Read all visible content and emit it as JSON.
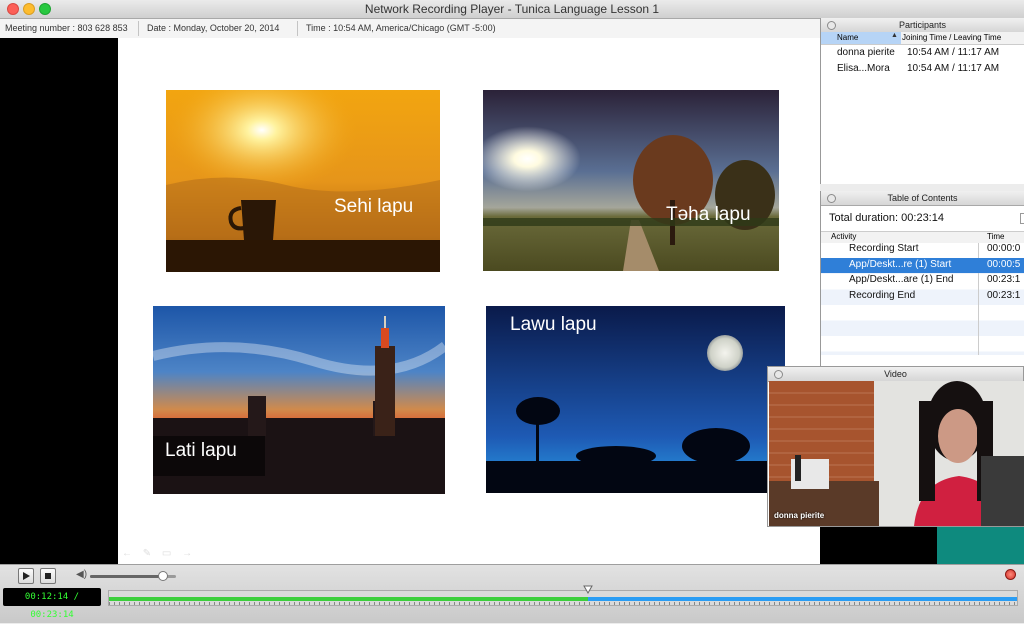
{
  "window": {
    "title": "Network Recording Player - Tunica Language Lesson 1"
  },
  "info": {
    "meeting": "Meeting number : 803 628 853",
    "date": "Date : Monday, October 20, 2014",
    "time": "Time : 10:54 AM, America/Chicago (GMT -5:00)"
  },
  "slide": {
    "captions": [
      "Sehi lapu",
      "Təha lapu",
      "Lati lapu",
      "Lawu lapu"
    ]
  },
  "participants": {
    "title": "Participants",
    "columns": [
      "Name",
      "Joining Time / Leaving Time"
    ],
    "rows": [
      {
        "name": "donna pierite",
        "times": "10:54 AM / 11:17 AM"
      },
      {
        "name": "Elisa...Mora",
        "times": "10:54 AM / 11:17 AM"
      }
    ]
  },
  "toc": {
    "title": "Table of Contents",
    "total": "Total duration: 00:23:14",
    "columns": [
      "Activity",
      "Time"
    ],
    "rows": [
      {
        "activity": "Recording Start",
        "time": "00:00:0"
      },
      {
        "activity": "App/Deskt...re (1) Start",
        "time": "00:00:5"
      },
      {
        "activity": "App/Deskt...are (1) End",
        "time": "00:23:1"
      },
      {
        "activity": "Recording End",
        "time": "00:23:1"
      }
    ],
    "selected_index": 1
  },
  "video": {
    "title": "Video",
    "name": "donna pierite"
  },
  "player": {
    "time_display": "00:12:14 / 00:23:14",
    "progress_fraction": 0.527,
    "volume_fraction": 0.85
  },
  "colors": {
    "accent_blue": "#2f7fd8",
    "progress_green": "#3ccf3c",
    "progress_blue": "#2a9df4"
  }
}
